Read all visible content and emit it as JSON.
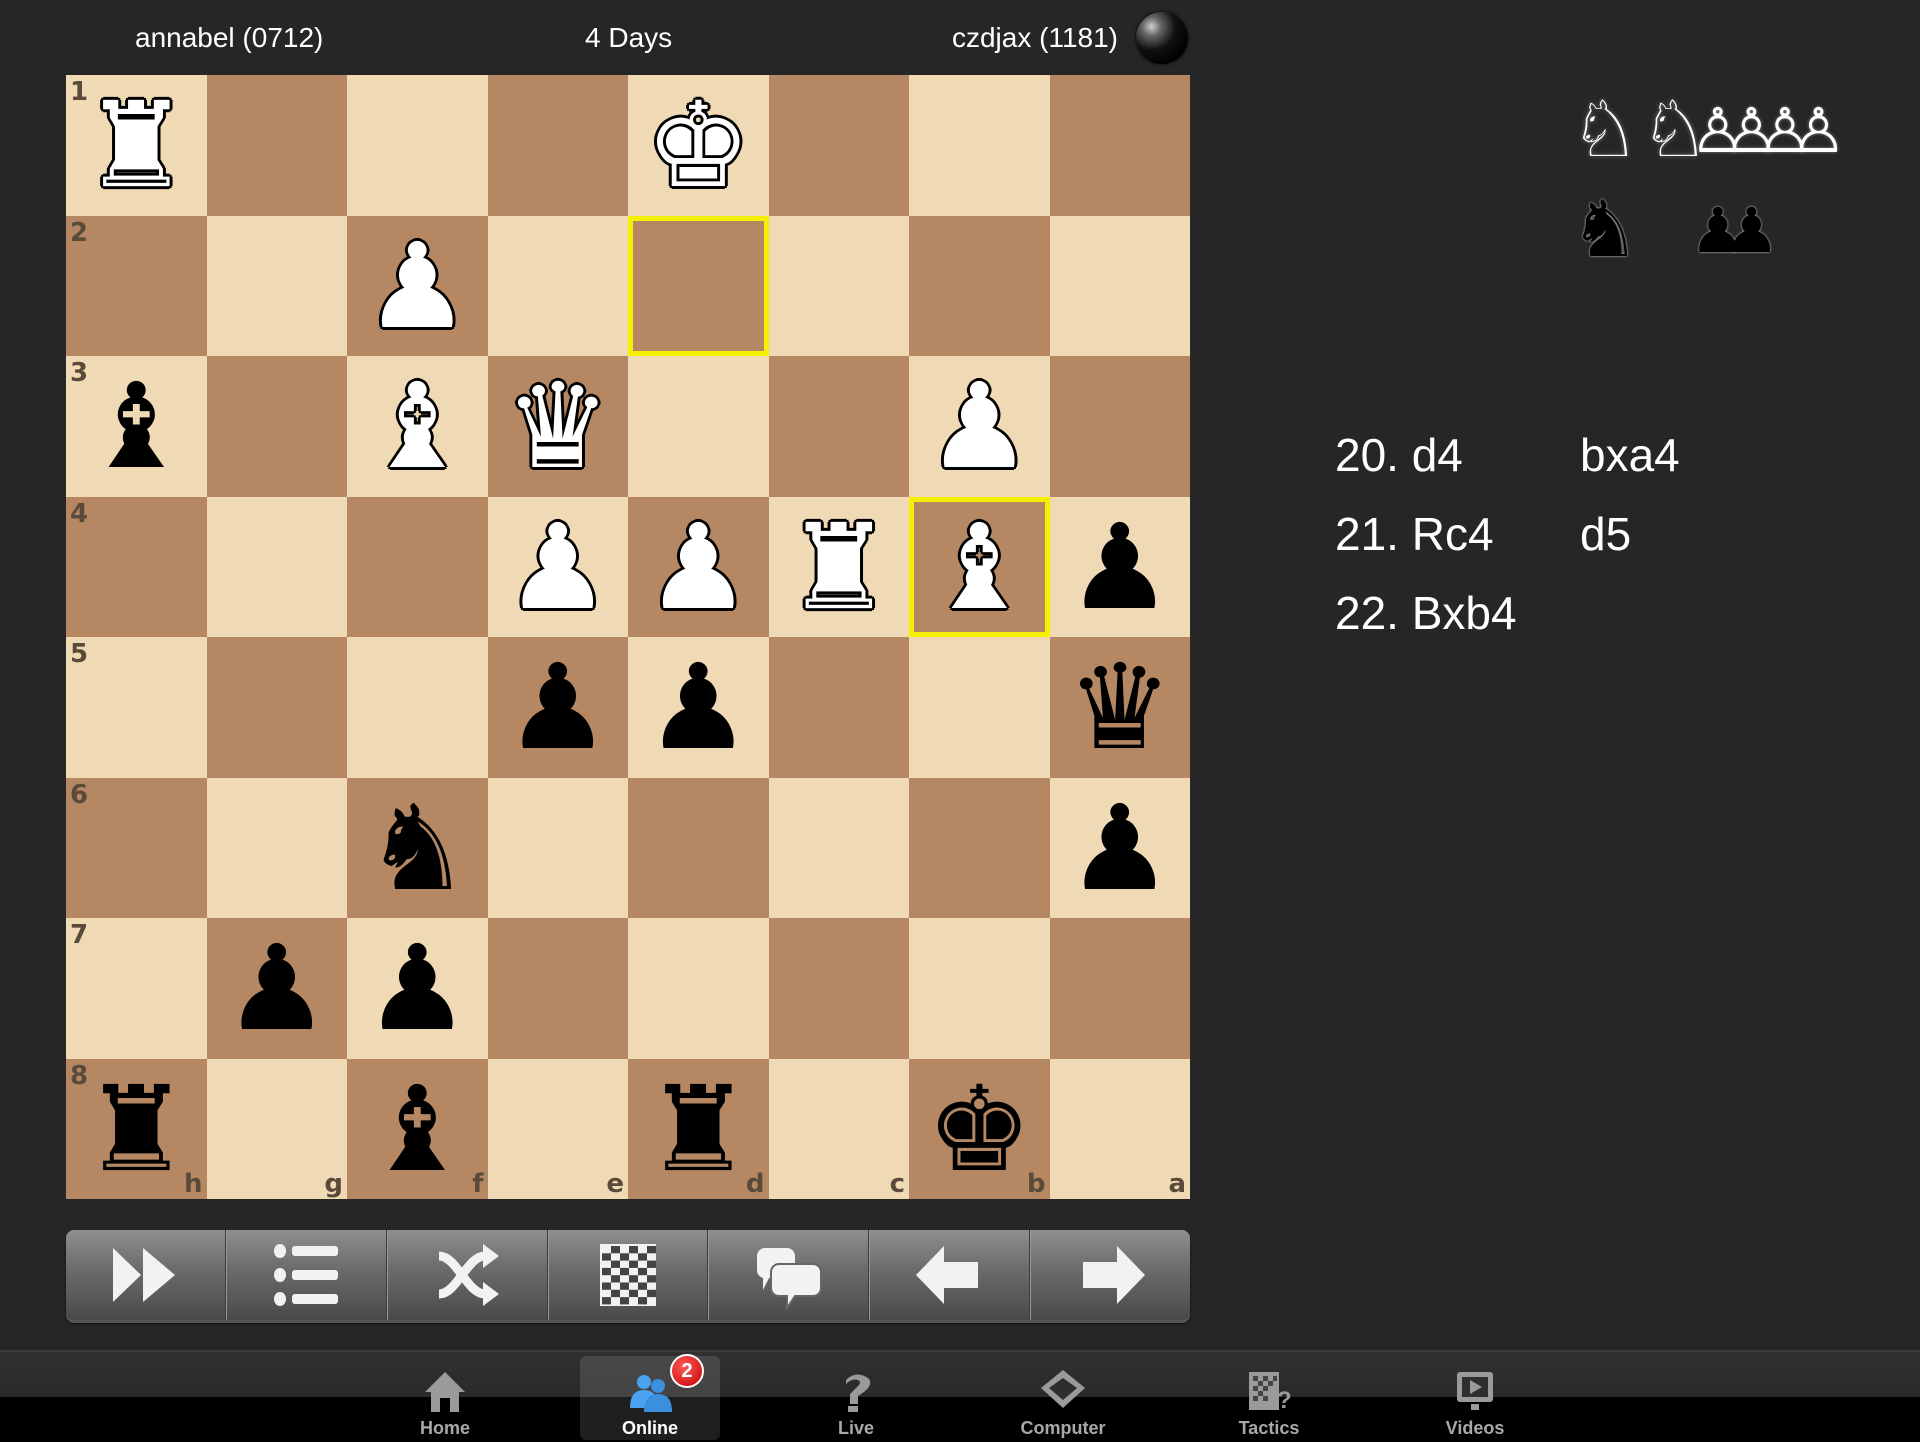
{
  "header": {
    "player_white": "annabel (0712)",
    "time_control": "4 Days",
    "player_black": "czdjax (1181)",
    "to_move": "black"
  },
  "board": {
    "orientation": "black-bottom",
    "files_display": [
      "h",
      "g",
      "f",
      "e",
      "d",
      "c",
      "b",
      "a"
    ],
    "ranks_display": [
      "1",
      "2",
      "3",
      "4",
      "5",
      "6",
      "7",
      "8"
    ],
    "light_color": "#f0d9b5",
    "dark_color": "#b58863",
    "highlight_color": "#f5f000",
    "highlighted_squares": [
      "d2",
      "b4"
    ],
    "pieces": {
      "h1": "wR",
      "d1": "wK",
      "f2": "wP",
      "h3": "bB",
      "f3": "wB",
      "e3": "wQ",
      "b3": "wP",
      "e4": "wP",
      "d4": "wP",
      "c4": "wR",
      "b4": "wB",
      "a4": "bP",
      "e5": "bP",
      "d5": "bP",
      "a5": "bQ",
      "f6": "bN",
      "a6": "bP",
      "g7": "bP",
      "f7": "bP",
      "h8": "bR",
      "f8": "bB",
      "d8": "bR",
      "b8": "bK"
    }
  },
  "captured": {
    "white_side": {
      "knights": 2,
      "pawns": 4
    },
    "black_side": {
      "knights": 1,
      "pawns": 2
    }
  },
  "moves": [
    {
      "white": "20. d4",
      "black": "bxa4"
    },
    {
      "white": "21. Rc4",
      "black": "d5"
    },
    {
      "white": "22. Bxb4",
      "black": ""
    }
  ],
  "toolbar": [
    {
      "name": "fast-forward-button",
      "icon": "fast-forward-icon"
    },
    {
      "name": "move-list-button",
      "icon": "list-icon"
    },
    {
      "name": "flip-board-button",
      "icon": "shuffle-icon"
    },
    {
      "name": "board-button",
      "icon": "checkerboard-icon"
    },
    {
      "name": "chat-button",
      "icon": "chat-bubbles-icon"
    },
    {
      "name": "previous-move-button",
      "icon": "arrow-left-icon"
    },
    {
      "name": "next-move-button",
      "icon": "arrow-right-icon"
    }
  ],
  "tabs": [
    {
      "label": "Home",
      "icon": "home-icon",
      "active": false
    },
    {
      "label": "Online",
      "icon": "users-icon",
      "active": true,
      "badge": "2"
    },
    {
      "label": "Live",
      "icon": "live-icon",
      "active": false
    },
    {
      "label": "Computer",
      "icon": "computer-chip-icon",
      "active": false
    },
    {
      "label": "Tactics",
      "icon": "tactics-icon",
      "active": false
    },
    {
      "label": "Videos",
      "icon": "video-icon",
      "active": false
    }
  ]
}
